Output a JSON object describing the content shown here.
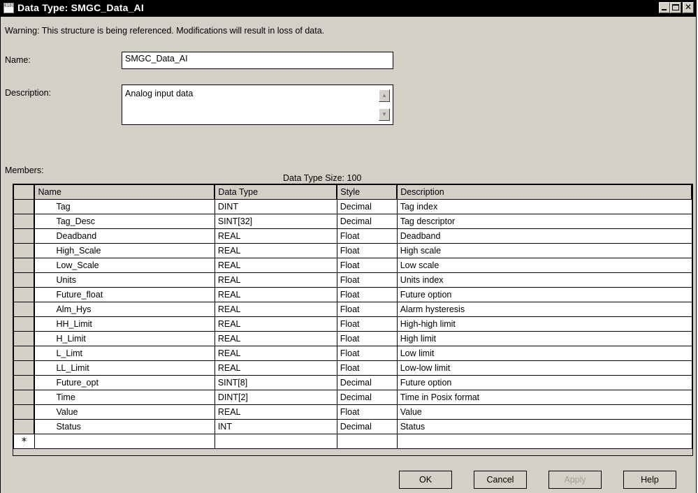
{
  "window": {
    "title": "Data Type:  SMGC_Data_AI",
    "icon_text": "0101"
  },
  "warning": "Warning: This structure is being referenced.  Modifications will result in loss of data.",
  "name": {
    "label": "Name:",
    "value": "SMGC_Data_AI"
  },
  "description": {
    "label": "Description:",
    "value": "Analog input data"
  },
  "members": {
    "label": "Members:",
    "size_text": "Data Type Size: 100",
    "columns": [
      "Name",
      "Data Type",
      "Style",
      "Description"
    ],
    "rows": [
      [
        "Tag",
        "DINT",
        "Decimal",
        "Tag index"
      ],
      [
        "Tag_Desc",
        "SINT[32]",
        "Decimal",
        "Tag descriptor"
      ],
      [
        "Deadband",
        "REAL",
        "Float",
        "Deadband"
      ],
      [
        "High_Scale",
        "REAL",
        "Float",
        "High scale"
      ],
      [
        "Low_Scale",
        "REAL",
        "Float",
        "Low scale"
      ],
      [
        "Units",
        "REAL",
        "Float",
        "Units index"
      ],
      [
        "Future_float",
        "REAL",
        "Float",
        "Future option"
      ],
      [
        "Alm_Hys",
        "REAL",
        "Float",
        "Alarm hysteresis"
      ],
      [
        "HH_Limit",
        "REAL",
        "Float",
        "High-high limit"
      ],
      [
        "H_Limit",
        "REAL",
        "Float",
        "High limit"
      ],
      [
        "L_Limt",
        "REAL",
        "Float",
        "Low limit"
      ],
      [
        "LL_Limit",
        "REAL",
        "Float",
        "Low-low limit"
      ],
      [
        "Future_opt",
        "SINT[8]",
        "Decimal",
        "Future option"
      ],
      [
        "Time",
        "DINT[2]",
        "Decimal",
        "Time in Posix format"
      ],
      [
        "Value",
        "REAL",
        "Float",
        "Value"
      ],
      [
        "Status",
        "INT",
        "Decimal",
        "Status"
      ]
    ],
    "new_row_marker": "*"
  },
  "buttons": {
    "ok": "OK",
    "cancel": "Cancel",
    "apply": "Apply",
    "help": "Help"
  }
}
